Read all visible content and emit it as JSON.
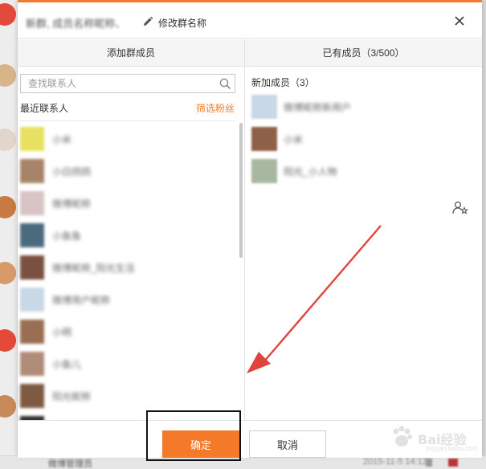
{
  "dialog": {
    "group_name": "新群, 成员名称昵称、",
    "rename_label": "修改群名称",
    "close_label": "×"
  },
  "left_panel": {
    "title": "添加群成员",
    "search_placeholder": "查找联系人",
    "recent_label": "最近联系人",
    "filter_label": "筛选粉丝",
    "contacts": [
      {
        "name": "小米",
        "avatar_color": "#e8e060"
      },
      {
        "name": "小白鸽鸽",
        "avatar_color": "#a78468"
      },
      {
        "name": "微博昵称",
        "avatar_color": "#d8c4c4"
      },
      {
        "name": "小鱼鱼",
        "avatar_color": "#4b6a80"
      },
      {
        "name": "微博昵称_阳光生活",
        "avatar_color": "#7a5040"
      },
      {
        "name": "微博用户昵称",
        "avatar_color": "#c9d8e6"
      },
      {
        "name": "小明",
        "avatar_color": "#9a6e52"
      },
      {
        "name": "小鱼儿",
        "avatar_color": "#b08b78"
      },
      {
        "name": "阳光昵称",
        "avatar_color": "#7e5a42"
      },
      {
        "name": "",
        "avatar_color": "#333333"
      }
    ]
  },
  "right_panel": {
    "title": "已有成员（3/500）",
    "new_members_label": "新加成员（3）",
    "members": [
      {
        "name": "微博昵称新用户",
        "avatar_color": "#c9d8e6"
      },
      {
        "name": "小米",
        "avatar_color": "#8f6048"
      },
      {
        "name": "阳光_小人物",
        "avatar_color": "#a8b8a0"
      }
    ]
  },
  "footer": {
    "confirm_label": "确定",
    "cancel_label": "取消"
  },
  "watermark": {
    "text": "Bai经验",
    "sub": "jingyan.baidu.com"
  },
  "bottom_strip": {
    "text": "微博管理员",
    "time": "2015-11-5 14:12"
  },
  "colors": {
    "accent": "#f47a2a",
    "arrow": "#e0453c"
  }
}
